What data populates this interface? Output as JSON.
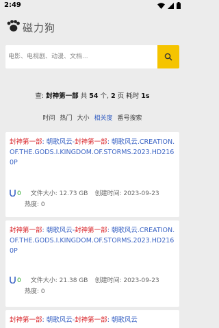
{
  "status_bar": {
    "time": "2:49"
  },
  "header": {
    "title": "磁力狗"
  },
  "search": {
    "placeholder": "电影、电视剧、动漫、文档...",
    "button_icon": "search-icon"
  },
  "summary": {
    "prefix": "查:",
    "query": "封神第一部",
    "mid1": "共",
    "count": "54",
    "mid2": "个,",
    "pages": "2",
    "mid3": "页 耗时",
    "time": "1s"
  },
  "sort_tabs": [
    {
      "label": "时间",
      "active": false
    },
    {
      "label": "热门",
      "active": false
    },
    {
      "label": "大小",
      "active": false
    },
    {
      "label": "相关度",
      "active": true
    },
    {
      "label": "番号搜索",
      "active": false
    }
  ],
  "results": [
    {
      "hl1": "封神第一部",
      "t1": ": 朝歌风云-",
      "hl2": "封神第一部",
      "t2": ": 朝歌风云.CREATION.OF.THE.GODS.I.KINGDOM.OF.STORMS.2023.HD2160P",
      "magnet_count": "0",
      "size_label": "文件大小:",
      "size": "12.73 GB",
      "created_label": "创建时间:",
      "created": "2023-09-23",
      "heat_label": "热度:",
      "heat": "0"
    },
    {
      "hl1": "封神第一部",
      "t1": ": 朝歌风云-",
      "hl2": "封神第一部",
      "t2": ": 朝歌风云.CREATION.OF.THE.GODS.I.KINGDOM.OF.STORMS.2023.HD2160P",
      "magnet_count": "0",
      "size_label": "文件大小:",
      "size": "21.38 GB",
      "created_label": "创建时间:",
      "created": "2023-09-23",
      "heat_label": "热度:",
      "heat": "0"
    },
    {
      "hl1": "封神第一部",
      "t1": ": 朝歌风云-",
      "hl2": "封神第一部",
      "t2": ": 朝歌风云"
    }
  ],
  "colors": {
    "accent": "#f5c400",
    "link": "#3a63c4",
    "highlight": "#d9262b",
    "count": "#2aa82a"
  }
}
